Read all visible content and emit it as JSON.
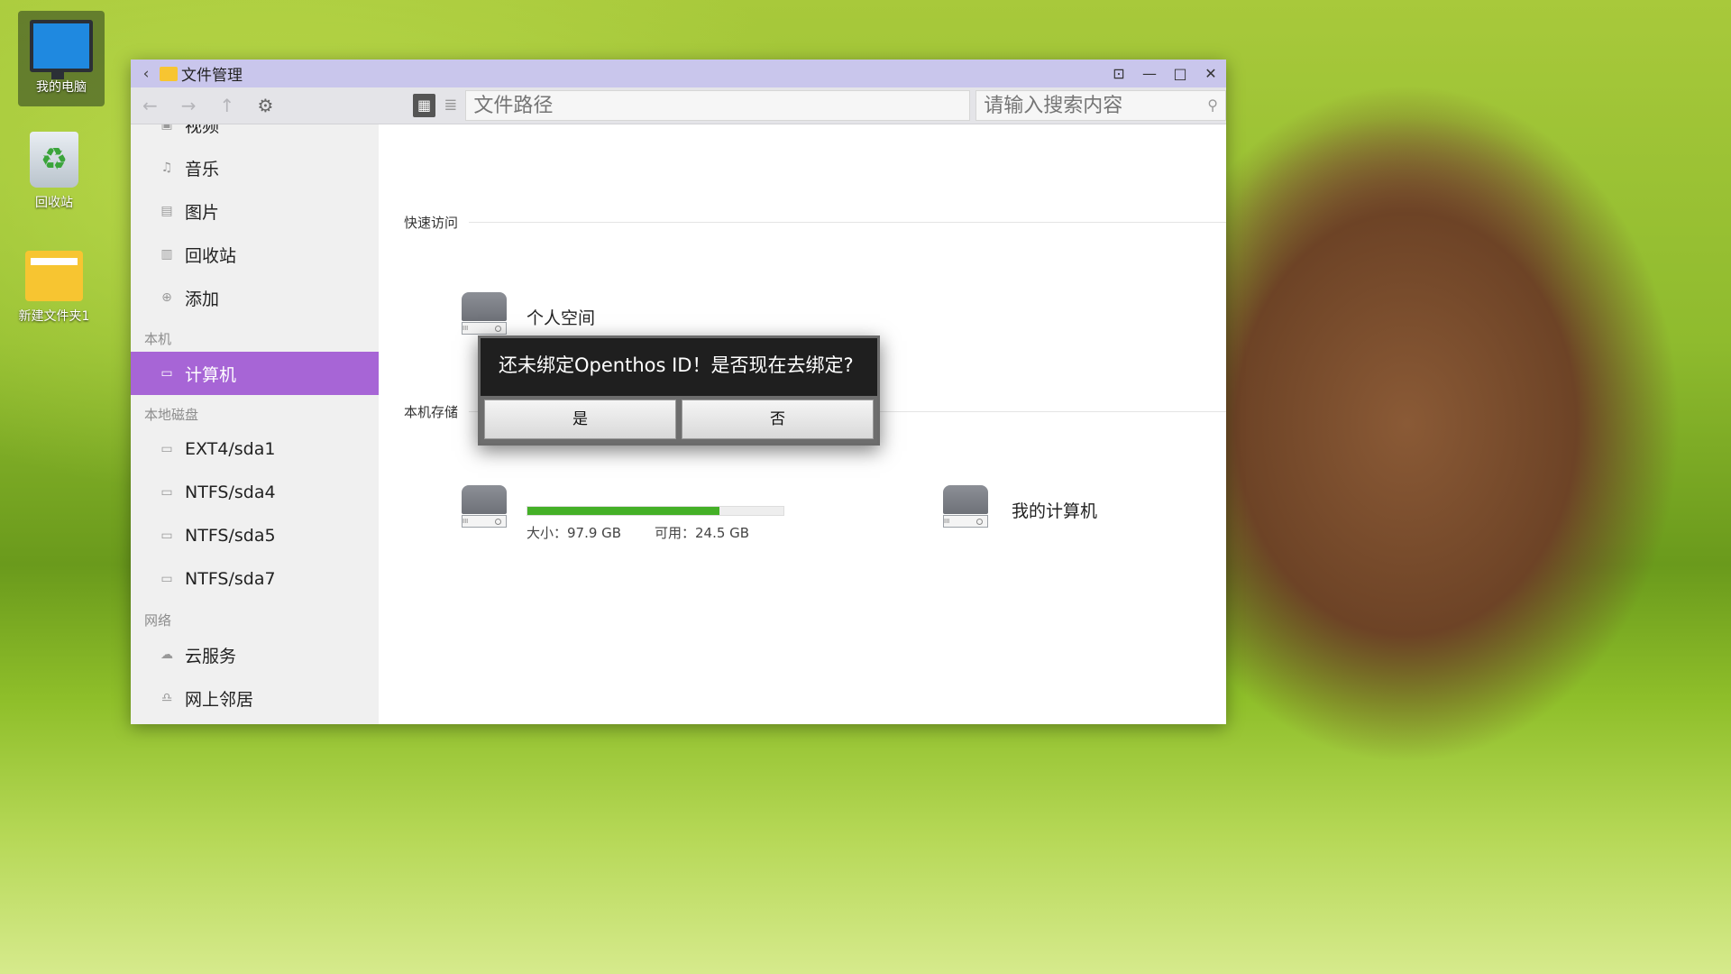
{
  "desktop": {
    "icons": [
      {
        "label": "我的电脑",
        "icon": "monitor-icon"
      },
      {
        "label": "回收站",
        "icon": "recycle-bin-icon"
      },
      {
        "label": "新建文件夹1",
        "icon": "folder-icon"
      }
    ]
  },
  "window": {
    "title": "文件管理",
    "back_glyph": "‹",
    "controls": {
      "pin": "⊡",
      "minimize": "—",
      "maximize": "□",
      "close": "✕"
    },
    "toolbar": {
      "back": "←",
      "forward": "→",
      "up": "↑",
      "settings": "⚙",
      "grid_view": "▦",
      "list_view": "≣",
      "path_placeholder": "文件路径",
      "search_placeholder": "请输入搜索内容",
      "search_icon": "⚲"
    },
    "sidebar": {
      "top_items": [
        {
          "label": "视频",
          "icon": "video-icon",
          "glyph": "▣"
        },
        {
          "label": "音乐",
          "icon": "music-icon",
          "glyph": "♫"
        },
        {
          "label": "图片",
          "icon": "picture-icon",
          "glyph": "▤"
        },
        {
          "label": "回收站",
          "icon": "trash-icon",
          "glyph": "▥"
        },
        {
          "label": "添加",
          "icon": "add-icon",
          "glyph": "⊕"
        }
      ],
      "section_local": "本机",
      "computer": {
        "label": "计算机",
        "icon": "computer-icon",
        "glyph": "▭"
      },
      "section_disks": "本地磁盘",
      "disks": [
        {
          "label": "EXT4/sda1",
          "icon": "disk-icon",
          "glyph": "▭"
        },
        {
          "label": "NTFS/sda4",
          "icon": "disk-icon",
          "glyph": "▭"
        },
        {
          "label": "NTFS/sda5",
          "icon": "disk-icon",
          "glyph": "▭"
        },
        {
          "label": "NTFS/sda7",
          "icon": "disk-icon",
          "glyph": "▭"
        }
      ],
      "section_network": "网络",
      "network": [
        {
          "label": "云服务",
          "icon": "cloud-icon",
          "glyph": "☁"
        },
        {
          "label": "网上邻居",
          "icon": "network-neighbor-icon",
          "glyph": "♎"
        }
      ]
    },
    "content": {
      "quick_access_title": "快速访问",
      "personal_space": "个人空间",
      "local_storage_title": "本机存储",
      "drive_size": "大小：97.9 GB",
      "drive_free": "可用：24.5 GB",
      "drive_used_fraction": 0.75,
      "my_computer": "我的计算机",
      "drive_bars_glyph": "III"
    }
  },
  "dialog": {
    "message": "还未绑定Openthos ID！是否现在去绑定?",
    "yes": "是",
    "no": "否"
  },
  "colors": {
    "titlebar": "#c9c6ec",
    "sidebar_active": "#a765d6",
    "progress_fill": "#44b027"
  }
}
